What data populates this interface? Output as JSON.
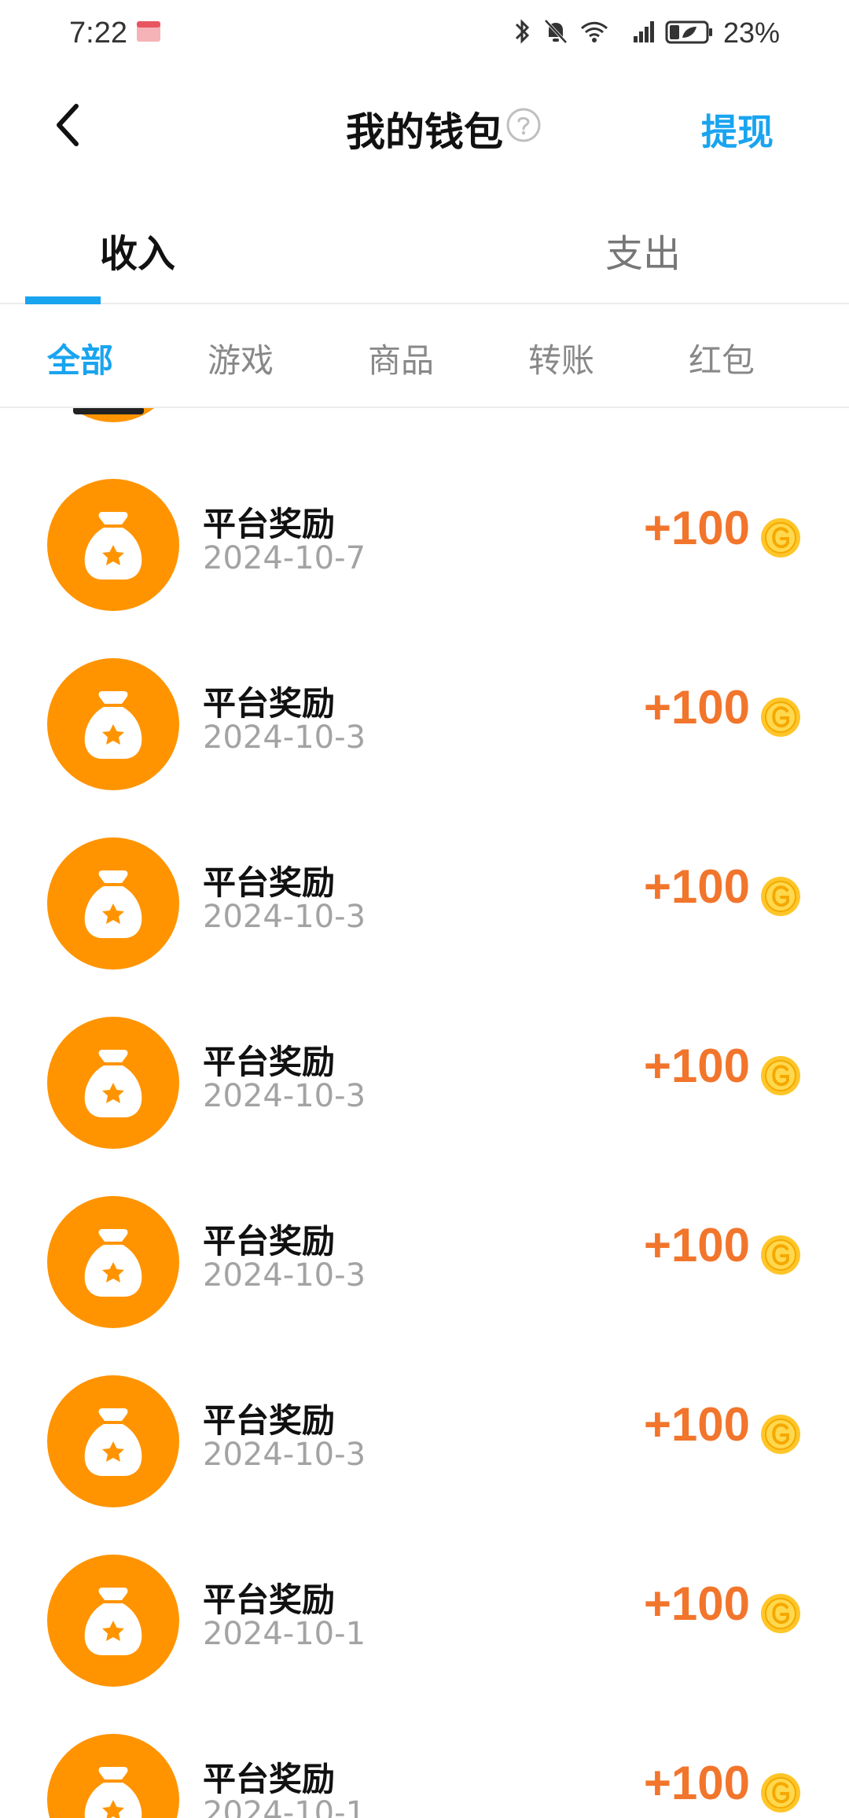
{
  "status_bar": {
    "time": "7:22",
    "battery": "23%"
  },
  "header": {
    "title": "我的钱包",
    "withdraw_label": "提现"
  },
  "main_tabs": [
    {
      "label": "收入",
      "active": true
    },
    {
      "label": "支出",
      "active": false
    }
  ],
  "sub_tabs": [
    {
      "label": "全部",
      "active": true
    },
    {
      "label": "游戏",
      "active": false
    },
    {
      "label": "商品",
      "active": false
    },
    {
      "label": "转账",
      "active": false
    },
    {
      "label": "红包",
      "active": false
    }
  ],
  "transactions": [
    {
      "title": "平台奖励",
      "date": "2024-10-7",
      "amount": "+100"
    },
    {
      "title": "平台奖励",
      "date": "2024-10-3",
      "amount": "+100"
    },
    {
      "title": "平台奖励",
      "date": "2024-10-3",
      "amount": "+100"
    },
    {
      "title": "平台奖励",
      "date": "2024-10-3",
      "amount": "+100"
    },
    {
      "title": "平台奖励",
      "date": "2024-10-3",
      "amount": "+100"
    },
    {
      "title": "平台奖励",
      "date": "2024-10-3",
      "amount": "+100"
    },
    {
      "title": "平台奖励",
      "date": "2024-10-1",
      "amount": "+100"
    },
    {
      "title": "平台奖励",
      "date": "2024-10-1",
      "amount": "+100"
    }
  ],
  "colors": {
    "accent": "#19A4F0",
    "avatar": "#FF9400",
    "amount": "#F2752C",
    "coin": "#FFC629"
  }
}
